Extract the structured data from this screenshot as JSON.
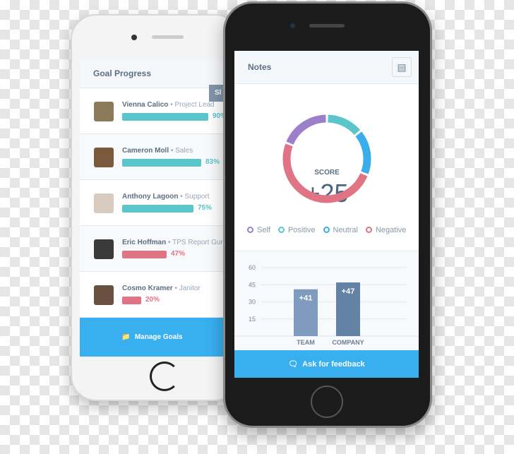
{
  "left_screen": {
    "title": "Goal Progress",
    "tab_peek": "Sl",
    "members": [
      {
        "name": "Vienna Calico",
        "role": "Project Lead",
        "progress": 90,
        "label": "90%",
        "color": "#5bc5cc"
      },
      {
        "name": "Cameron Moll",
        "role": "Sales",
        "progress": 83,
        "label": "83%",
        "color": "#5bc5cc"
      },
      {
        "name": "Anthony Lagoon",
        "role": "Support",
        "progress": 75,
        "label": "75%",
        "color": "#5bc5cc"
      },
      {
        "name": "Eric Hoffman",
        "role": "TPS Report Guru",
        "progress": 47,
        "label": "47%",
        "color": "#e07384"
      },
      {
        "name": "Cosmo Kramer",
        "role": "Janitor",
        "progress": 20,
        "label": "20%",
        "color": "#e07384"
      }
    ],
    "manage_button": "Manage Goals"
  },
  "right_screen": {
    "title": "Notes",
    "score_label": "SCORE",
    "score_value": "+25",
    "donut": [
      {
        "name": "Self",
        "color": "#9b7fcb",
        "share": 0.19
      },
      {
        "name": "Positive",
        "color": "#5bc5cc",
        "share": 0.14
      },
      {
        "name": "Neutral",
        "color": "#3aaeea",
        "share": 0.17
      },
      {
        "name": "Negative",
        "color": "#e07384",
        "share": 0.5
      }
    ],
    "legend": [
      "Self",
      "Positive",
      "Neutral",
      "Negative"
    ],
    "ask_button": "Ask for feedback"
  },
  "chart_data": {
    "type": "bar",
    "categories": [
      "TEAM",
      "COMPANY"
    ],
    "values": [
      41,
      47
    ],
    "data_labels": [
      "+41",
      "+47"
    ],
    "colors": [
      "#7f9cbf",
      "#6482a4"
    ],
    "yticks": [
      15,
      30,
      45,
      60
    ],
    "ylim": [
      0,
      60
    ],
    "grid": true
  }
}
